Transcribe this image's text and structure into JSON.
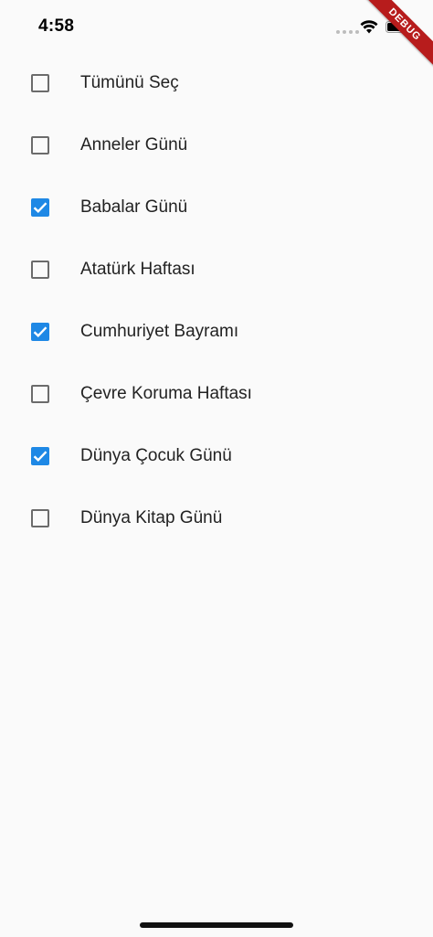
{
  "status_bar": {
    "time": "4:58"
  },
  "debug_banner": {
    "label": "DEBUG"
  },
  "colors": {
    "checkbox_checked": "#1e88e5",
    "checkbox_unchecked_border": "#6b6b6b",
    "background": "#fafafa",
    "debug_ribbon": "#b71c1c"
  },
  "items": [
    {
      "label": "Tümünü Seç",
      "checked": false
    },
    {
      "label": "Anneler Günü",
      "checked": false
    },
    {
      "label": "Babalar Günü",
      "checked": true
    },
    {
      "label": "Atatürk Haftası",
      "checked": false
    },
    {
      "label": "Cumhuriyet Bayramı",
      "checked": true
    },
    {
      "label": "Çevre Koruma Haftası",
      "checked": false
    },
    {
      "label": "Dünya Çocuk Günü",
      "checked": true
    },
    {
      "label": "Dünya Kitap Günü",
      "checked": false
    }
  ]
}
